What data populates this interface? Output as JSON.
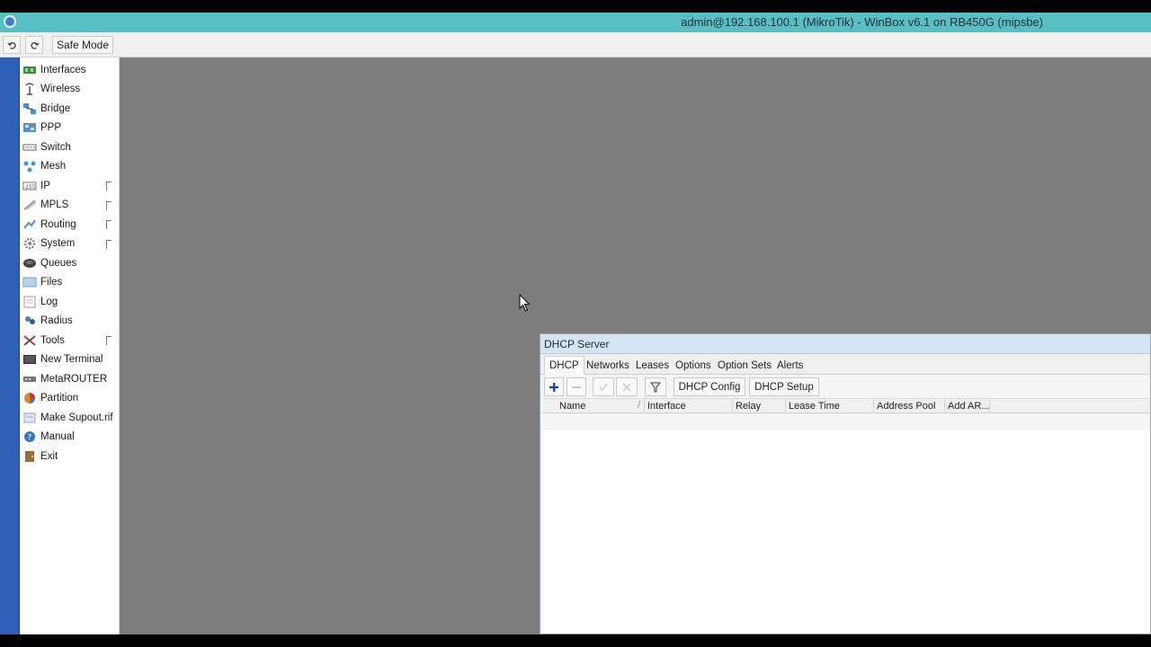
{
  "window": {
    "title": "admin@192.168.100.1 (MikroTik) - WinBox v6.1 on RB450G (mipsbe)"
  },
  "toolbar": {
    "undo_icon": "undo-icon",
    "redo_icon": "redo-icon",
    "safe_mode_label": "Safe Mode"
  },
  "menu": {
    "items": [
      {
        "label": "Interfaces",
        "icon": "interfaces-icon",
        "submenu": false
      },
      {
        "label": "Wireless",
        "icon": "wireless-icon",
        "submenu": false
      },
      {
        "label": "Bridge",
        "icon": "bridge-icon",
        "submenu": false
      },
      {
        "label": "PPP",
        "icon": "ppp-icon",
        "submenu": false
      },
      {
        "label": "Switch",
        "icon": "switch-icon",
        "submenu": false
      },
      {
        "label": "Mesh",
        "icon": "mesh-icon",
        "submenu": false
      },
      {
        "label": "IP",
        "icon": "ip-icon",
        "submenu": true
      },
      {
        "label": "MPLS",
        "icon": "mpls-icon",
        "submenu": true
      },
      {
        "label": "Routing",
        "icon": "routing-icon",
        "submenu": true
      },
      {
        "label": "System",
        "icon": "system-gear-icon",
        "submenu": true
      },
      {
        "label": "Queues",
        "icon": "queues-icon",
        "submenu": false
      },
      {
        "label": "Files",
        "icon": "folder-icon",
        "submenu": false
      },
      {
        "label": "Log",
        "icon": "log-icon",
        "submenu": false
      },
      {
        "label": "Radius",
        "icon": "radius-icon",
        "submenu": false
      },
      {
        "label": "Tools",
        "icon": "tools-icon",
        "submenu": true
      },
      {
        "label": "New Terminal",
        "icon": "terminal-icon",
        "submenu": false
      },
      {
        "label": "MetaROUTER",
        "icon": "metarouter-icon",
        "submenu": false
      },
      {
        "label": "Partition",
        "icon": "partition-icon",
        "submenu": false
      },
      {
        "label": "Make Supout.rif",
        "icon": "supout-icon",
        "submenu": false
      },
      {
        "label": "Manual",
        "icon": "help-icon",
        "submenu": false
      },
      {
        "label": "Exit",
        "icon": "exit-icon",
        "submenu": false
      }
    ]
  },
  "dhcp": {
    "title": "DHCP Server",
    "tabs": [
      "DHCP",
      "Networks",
      "Leases",
      "Options",
      "Option Sets",
      "Alerts"
    ],
    "active_tab": "DHCP",
    "buttons": {
      "config": "DHCP Config",
      "setup": "DHCP Setup"
    },
    "columns": [
      "Name",
      "Interface",
      "Relay",
      "Lease Time",
      "Address Pool",
      "Add AR..."
    ],
    "sort_indicator": "/",
    "rows": []
  },
  "colors": {
    "titlebar": "#58c0c4",
    "side_strip": "#2f60b8",
    "workspace": "#7d7d7d"
  }
}
